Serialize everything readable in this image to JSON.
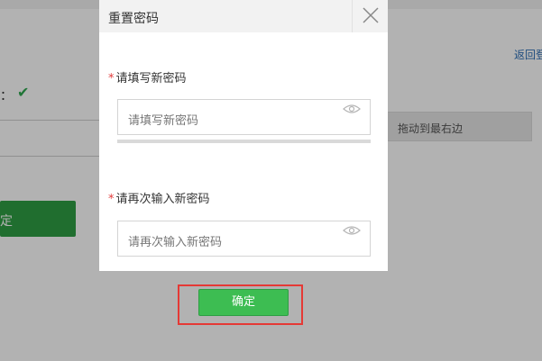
{
  "background": {
    "back_link": "返回登",
    "label_fragment": "：",
    "slider_text": "拖动到最右边",
    "green_button_fragment": "定"
  },
  "modal": {
    "title": "重置密码",
    "close_icon": "close-icon",
    "new_password": {
      "required_mark": "*",
      "label": "请填写新密码",
      "placeholder": "请填写新密码",
      "toggle_icon": "eye-icon"
    },
    "confirm_password": {
      "required_mark": "*",
      "label": "请再次输入新密码",
      "placeholder": "请再次输入新密码",
      "toggle_icon": "eye-icon"
    }
  },
  "confirm_button": {
    "label": "确定"
  },
  "colors": {
    "accent_green": "#3dbd52",
    "required_red": "#e23b3b",
    "highlight_red": "#e53935",
    "link_blue": "#2d6fb6"
  }
}
